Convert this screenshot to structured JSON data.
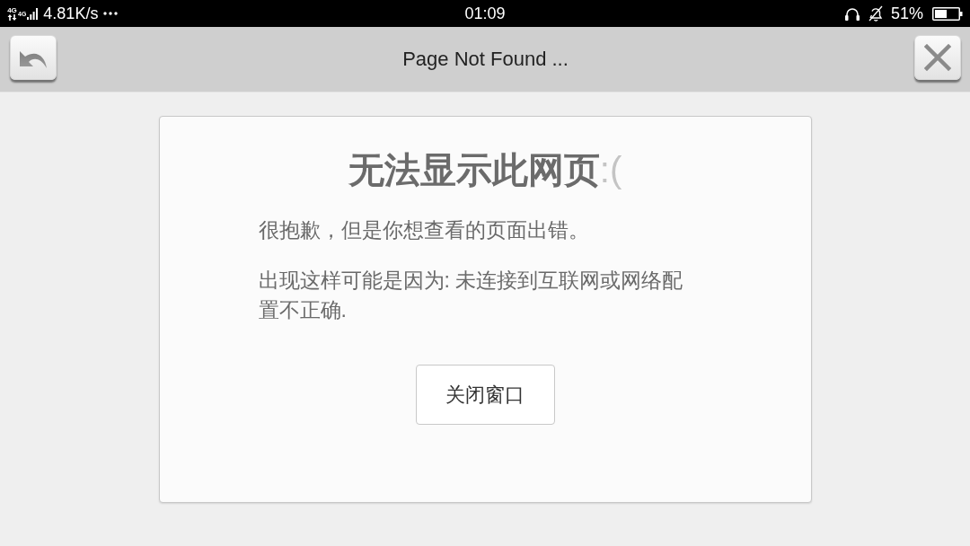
{
  "status_bar": {
    "network_labels": [
      "4G",
      "4G"
    ],
    "speed": "4.81K/s",
    "time": "01:09",
    "battery_percent": "51%"
  },
  "toolbar": {
    "title": "Page Not Found ..."
  },
  "error_card": {
    "title": "无法显示此网页",
    "emoticon": ":(",
    "message": "很抱歉，但是你想查看的页面出错。",
    "reason": "出现这样可能是因为: 未连接到互联网或网络配置不正确.",
    "button": "关闭窗口"
  }
}
